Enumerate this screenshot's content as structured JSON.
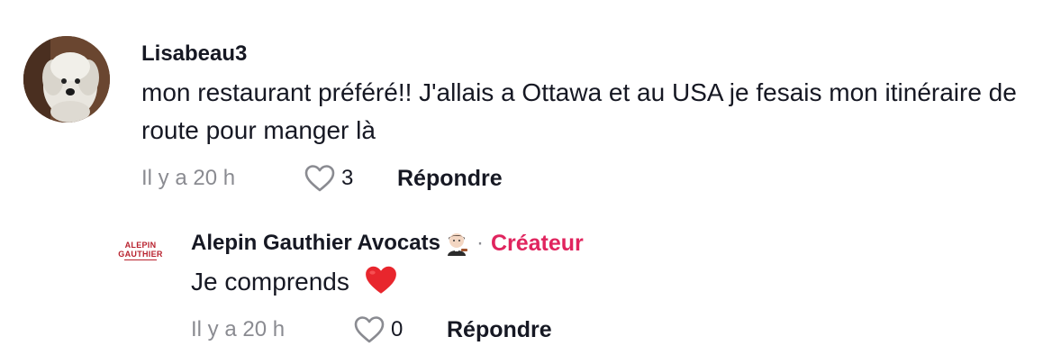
{
  "comments": [
    {
      "username": "Lisabeau3",
      "text": "mon restaurant préféré!! J'allais a Ottawa et au USA je fesais mon itinéraire de route pour manger là",
      "time": "Il y a 20 h",
      "likes": "3",
      "reply_label": "Répondre",
      "avatar_icon": "dog-avatar"
    },
    {
      "username": "Alepin Gauthier Avocats",
      "separator": "·",
      "badge": "Créateur",
      "text": "Je comprends",
      "time": "Il y a 20 h",
      "likes": "0",
      "reply_label": "Répondre",
      "avatar_logo_line1": "ALEPIN",
      "avatar_logo_line2": "GAUTHIER",
      "name_emoji_icon": "woman-judge-emoji-icon",
      "text_emoji_icon": "red-heart-emoji-icon"
    }
  ],
  "colors": {
    "text": "#161823",
    "muted": "#8a8b91",
    "creator": "#e0245e",
    "logo": "#b8222e",
    "heart": "#e8262d"
  }
}
